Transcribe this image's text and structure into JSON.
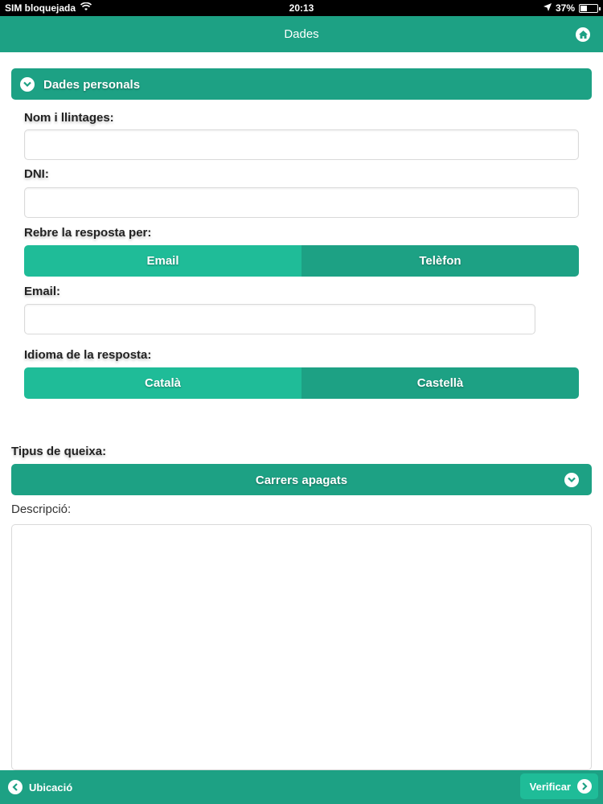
{
  "status_bar": {
    "carrier": "SIM bloquejada",
    "time": "20:13",
    "battery": "37%",
    "battery_level": 0.37
  },
  "header": {
    "title": "Dades",
    "home_icon": "home-icon"
  },
  "personal_section": {
    "title": "Dades personals",
    "fields": {
      "name_label": "Nom i llintages:",
      "name_value": "",
      "dni_label": "DNI:",
      "dni_value": "",
      "reply_by_label": "Rebre la resposta per:",
      "reply_by_options": [
        "Email",
        "Telèfon"
      ],
      "reply_by_selected": "Email",
      "email_label": "Email:",
      "email_value": "",
      "language_label": "Idioma de la resposta:",
      "language_options": [
        "Català",
        "Castellà"
      ],
      "language_selected": "Català"
    }
  },
  "complaint": {
    "type_label": "Tipus de queixa:",
    "type_value": "Carrers apagats",
    "description_label": "Descripció:",
    "description_value": ""
  },
  "footer": {
    "back_label": "Ubicació",
    "next_label": "Verificar"
  },
  "colors": {
    "primary": "#1da184",
    "active": "#1fbc98"
  }
}
